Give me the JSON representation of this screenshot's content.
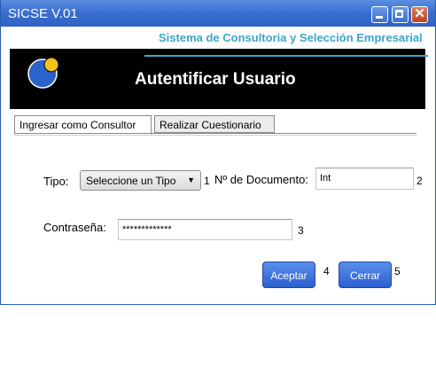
{
  "window": {
    "title": "SICSE V.01",
    "controls": {
      "minimize": "minimize-icon",
      "maximize": "maximize-icon",
      "close": "close-icon"
    }
  },
  "header": {
    "tagline": "Sistema de Consultoria y Selección Empresarial",
    "banner_title": "Autentificar Usuario",
    "colors": {
      "accent": "#3fa5c8",
      "banner_bg": "#000000",
      "logo_blue": "#2a63c9",
      "logo_yellow": "#f2c21b"
    }
  },
  "tabs": [
    {
      "label": "Ingresar como Consultor",
      "active": true
    },
    {
      "label": "Realizar Cuestionario",
      "active": false
    }
  ],
  "form": {
    "tipo_label": "Tipo:",
    "tipo_selected": "Seleccione un Tipo",
    "marker_1": "1",
    "documento_label": "Nº de Documento:",
    "documento_value": "Int",
    "marker_2": "2",
    "password_label": "Contraseña:",
    "password_value": "*************",
    "marker_3": "3"
  },
  "actions": {
    "accept_label": "Aceptar",
    "marker_4": "4",
    "close_label": "Cerrar",
    "marker_5": "5",
    "button_color": "#2d5fd0"
  }
}
